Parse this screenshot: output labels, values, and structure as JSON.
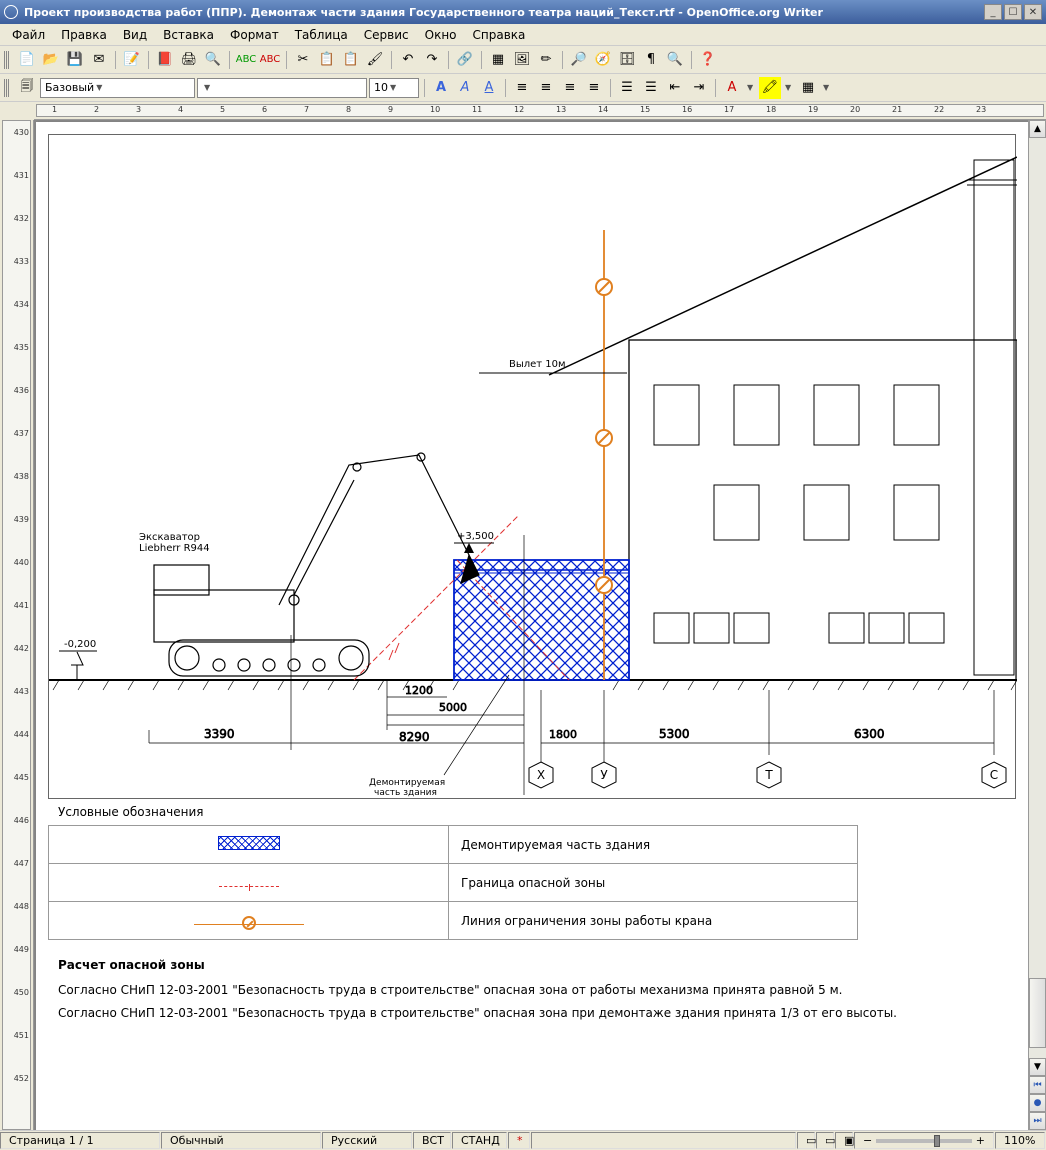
{
  "window": {
    "title": "Проект производства работ (ППР). Демонтаж части здания Государственного театра наций_Текст.rtf - OpenOffice.org Writer"
  },
  "menu": [
    "Файл",
    "Правка",
    "Вид",
    "Вставка",
    "Формат",
    "Таблица",
    "Сервис",
    "Окно",
    "Справка"
  ],
  "format_bar": {
    "style": "Базовый",
    "font": "",
    "size": "10"
  },
  "ruler_v": [
    430,
    431,
    432,
    433,
    434,
    435,
    436,
    437,
    438,
    439,
    440,
    441,
    442,
    443,
    444,
    445,
    446,
    447,
    448,
    449,
    450,
    451,
    452
  ],
  "ruler_h": [
    1,
    2,
    3,
    4,
    5,
    6,
    7,
    8,
    9,
    10,
    11,
    12,
    13,
    14,
    15,
    16,
    17,
    18,
    19,
    20,
    21,
    22,
    23
  ],
  "drawing": {
    "labels": {
      "excavator": "Экскаватор Liebherr R944",
      "boom": "Вылет 10м",
      "elev_top": "+3,500",
      "elev_ground": "-0,200",
      "demol_note": "Демонтируемая часть здания"
    },
    "dims": {
      "d3390": "3390",
      "d1200": "1200",
      "d5000": "5000",
      "d8290": "8290",
      "d1800": "1800",
      "d5300": "5300",
      "d6300": "6300"
    },
    "axes": [
      "Х",
      "У",
      "Т",
      "С"
    ]
  },
  "legend": {
    "title": "Условные обозначения",
    "rows": [
      "Демонтируемая часть здания",
      "Граница опасной зоны",
      "Линия ограничения зоны работы крана"
    ]
  },
  "section": {
    "title": "Расчет опасной зоны",
    "p1": "Согласно СНиП 12-03-2001 \"Безопасность труда в строительстве\" опасная зона от работы механизма принята равной 5 м.",
    "p2": "Согласно СНиП 12-03-2001 \"Безопасность труда в строительстве\" опасная зона при демонтаже здания принята 1/3 от его высоты."
  },
  "status": {
    "page": "Страница  1 / 1",
    "style": "Обычный",
    "lang": "Русский",
    "ins": "ВСТ",
    "std": "СТАНД",
    "zoom": "110%"
  }
}
